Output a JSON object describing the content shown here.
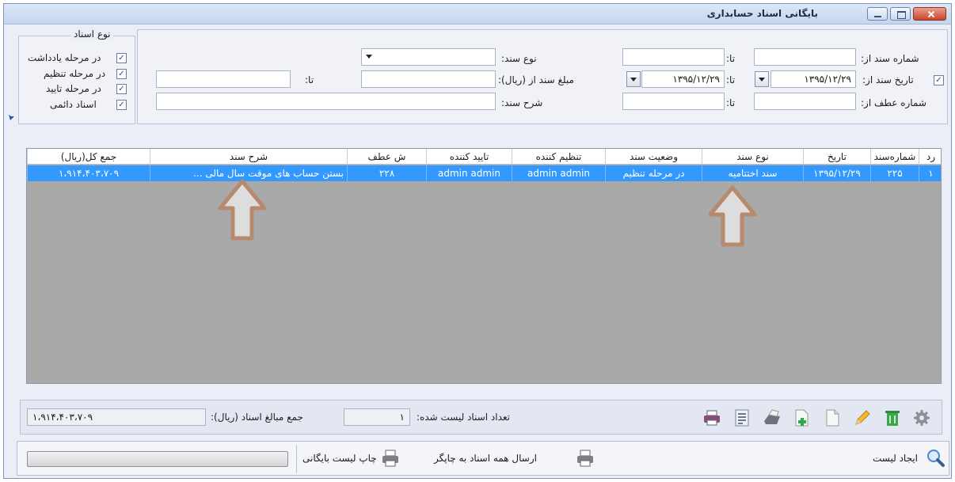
{
  "window": {
    "title": "بایگانی اسناد حسابداری"
  },
  "filters": {
    "doc_number_from_label": "شماره سند از:",
    "doc_number_to_label": "تا:",
    "doc_type_label": "نوع سند:",
    "doc_date_from_label": "تاریخ سند از:",
    "doc_date_from_value": "۱۳۹۵/۱۲/۲۹",
    "doc_date_to_label": "تا:",
    "doc_date_to_value": "۱۳۹۵/۱۲/۲۹",
    "amount_from_label": "مبلغ سند از (ریال):",
    "amount_to_label": "تا:",
    "ref_number_from_label": "شماره عطف از:",
    "ref_number_to_label": "تا:",
    "description_label": "شرح سند:"
  },
  "doc_types_group": {
    "title": "نوع اسناد",
    "items": [
      {
        "label": "در مرحله یادداشت",
        "checked": true
      },
      {
        "label": "در مرحله تنظیم",
        "checked": true
      },
      {
        "label": "در مرحله تایید",
        "checked": true
      },
      {
        "label": "اسناد دائمی",
        "checked": true
      }
    ]
  },
  "grid": {
    "columns": [
      "رد",
      "شماره‌سند",
      "تاریخ",
      "نوع سند",
      "وضعیت سند",
      "تنظیم کننده",
      "تایید کننده",
      "ش عطف",
      "شرح سند",
      "جمع کل(ریال)"
    ],
    "rows": [
      [
        "۱",
        "۲۲۵",
        "۱۳۹۵/۱۲/۲۹",
        "سند اختتامیه",
        "در مرحله تنظیم",
        "admin admin",
        "admin admin",
        "۲۲۸",
        "بستن حساب های موقت سال مالی ...",
        "۱،۹۱۴،۴۰۳،۷۰۹"
      ]
    ]
  },
  "summary": {
    "count_label": "تعداد اسناد لیست شده:",
    "count_value": "۱",
    "total_label": "جمع مبالغ اسناد (ریال):",
    "total_value": "۱،۹۱۴،۴۰۳،۷۰۹"
  },
  "footer": {
    "create_list_label": "ایجاد لیست",
    "send_all_label": "ارسال همه اسناد به چاپگر",
    "print_list_label": "چاپ لیست بایگانی"
  },
  "colors": {
    "selection": "#3399ff",
    "grid_background": "#a9a9a9",
    "annotation_arrow": "#b78a6d"
  }
}
